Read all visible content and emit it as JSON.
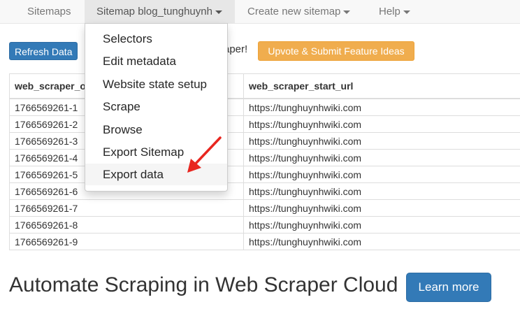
{
  "nav": {
    "sitemaps": "Sitemaps",
    "current_sitemap": "Sitemap blog_tunghuynh",
    "create_new": "Create new sitemap",
    "help": "Help"
  },
  "dropdown": {
    "items": [
      "Selectors",
      "Edit metadata",
      "Website state setup",
      "Scrape",
      "Browse",
      "Export Sitemap",
      "Export data"
    ],
    "hovered": "Export data"
  },
  "toolbar": {
    "refresh_label": "Refresh Data",
    "promo_fragment": "aper!",
    "upvote_label": "Upvote & Submit Feature Ideas"
  },
  "table": {
    "columns": [
      "web_scraper_o",
      "web_scraper_start_url"
    ],
    "rows": [
      [
        "1766569261-1",
        "https://tunghuynhwiki.com"
      ],
      [
        "1766569261-2",
        "https://tunghuynhwiki.com"
      ],
      [
        "1766569261-3",
        "https://tunghuynhwiki.com"
      ],
      [
        "1766569261-4",
        "https://tunghuynhwiki.com"
      ],
      [
        "1766569261-5",
        "https://tunghuynhwiki.com"
      ],
      [
        "1766569261-6",
        "https://tunghuynhwiki.com"
      ],
      [
        "1766569261-7",
        "https://tunghuynhwiki.com"
      ],
      [
        "1766569261-8",
        "https://tunghuynhwiki.com"
      ],
      [
        "1766569261-9",
        "https://tunghuynhwiki.com"
      ]
    ]
  },
  "cta": {
    "title": "Automate Scraping in Web Scraper Cloud",
    "button": "Learn more"
  },
  "colors": {
    "primary": "#337ab7",
    "warning": "#f0ad4e",
    "arrow": "#e8261f"
  }
}
